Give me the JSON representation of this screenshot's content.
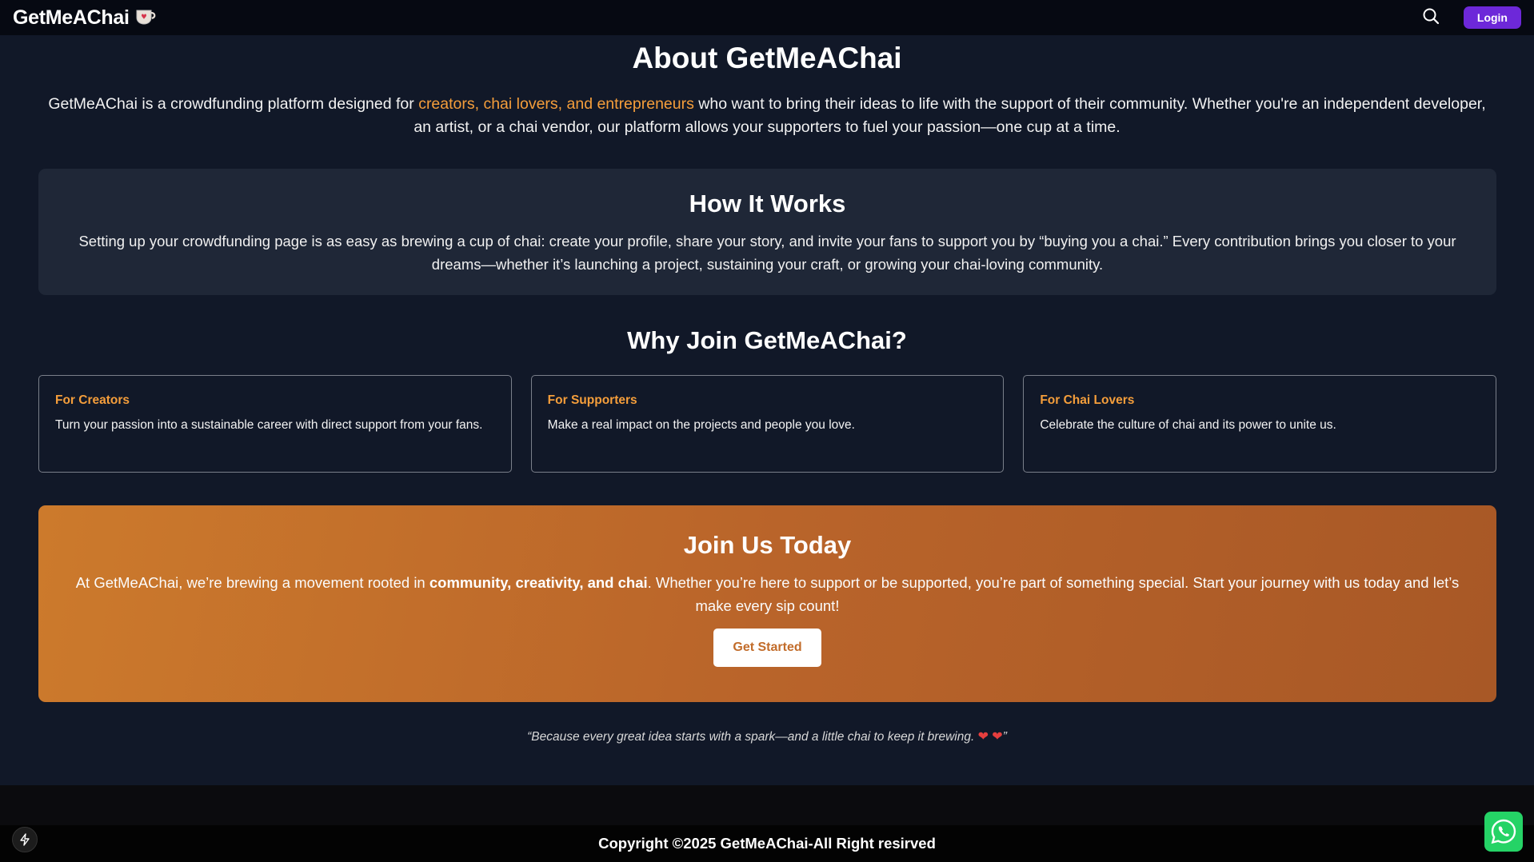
{
  "navbar": {
    "brand": "GetMeAChai",
    "brand_icon": "chai-cup-icon",
    "search_icon": "search-icon",
    "login_label": "Login"
  },
  "about": {
    "title": "About GetMeAChai",
    "desc_before": "GetMeAChai is a crowdfunding platform designed for ",
    "desc_highlight": "creators, chai lovers, and entrepreneurs",
    "desc_after": " who want to bring their ideas to life with the support of their community. Whether you're an independent developer, an artist, or a chai vendor, our platform allows your supporters to fuel your passion—one cup at a time."
  },
  "how": {
    "title": "How It Works",
    "desc": "Setting up your crowdfunding page is as easy as brewing a cup of chai: create your profile, share your story, and invite your fans to support you by “buying you a chai.” Every contribution brings you closer to your dreams—whether it’s launching a project, sustaining your craft, or growing your chai-loving community."
  },
  "why": {
    "title": "Why Join GetMeAChai?",
    "cards": [
      {
        "title": "For Creators",
        "desc": "Turn your passion into a sustainable career with direct support from your fans."
      },
      {
        "title": "For Supporters",
        "desc": "Make a real impact on the projects and people you love."
      },
      {
        "title": "For Chai Lovers",
        "desc": "Celebrate the culture of chai and its power to unite us."
      }
    ]
  },
  "join": {
    "title": "Join Us Today",
    "desc_before": "At GetMeAChai, we’re brewing a movement rooted in ",
    "desc_bold": "community, creativity, and chai",
    "desc_after": ". Whether you’re here to support or be supported, you’re part of something special. Start your journey with us today and let’s make every sip count!",
    "button_label": "Get Started"
  },
  "quote": {
    "text": "“Because every great idea starts with a spark—and a little chai to keep it brewing. ",
    "heart1": "❤",
    "heart2": "❤",
    "close": "”"
  },
  "footer": {
    "copyright": "Copyright ©2025 GetMeAChai-All Right resirved",
    "bolt_icon": "lightning-icon",
    "whatsapp_icon": "whatsapp-icon"
  },
  "colors": {
    "accent": "#f59e3b",
    "login": "#6d28d9",
    "join_gradient_start": "#cc7a2c",
    "join_gradient_end": "#a85826"
  }
}
